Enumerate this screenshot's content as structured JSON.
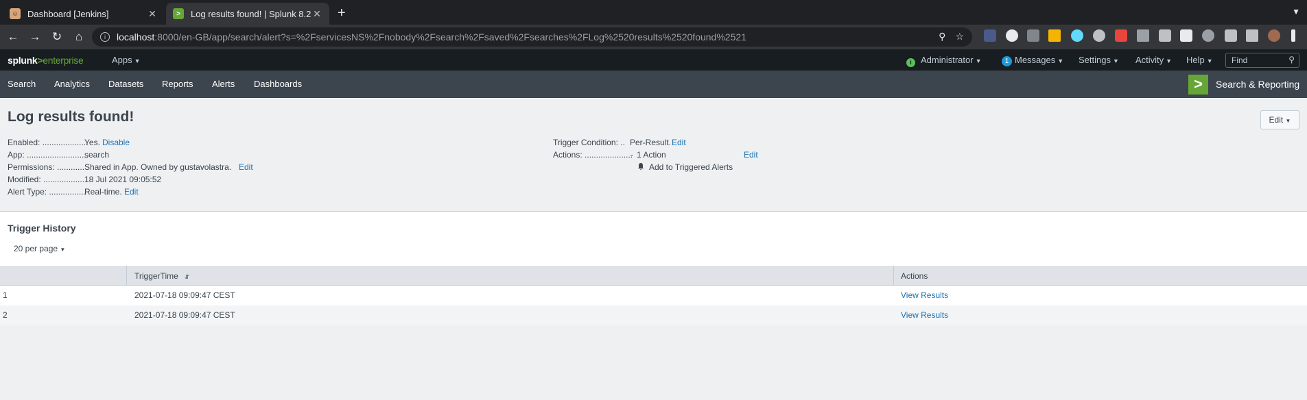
{
  "browser": {
    "tabs": [
      {
        "title": "Dashboard [Jenkins]",
        "active": false
      },
      {
        "title": "Log results found! | Splunk 8.2",
        "active": true
      }
    ],
    "url_host": "localhost",
    "url_rest": ":8000/en-GB/app/search/alert?s=%2FservicesNS%2Fnobody%2Fsearch%2Fsaved%2Fsearches%2FLog%2520results%2520found%2521"
  },
  "splunk_header": {
    "logo_main": "splunk",
    "logo_gt": ">",
    "logo_sub": "enterprise",
    "apps_label": "Apps",
    "user_label": "Administrator",
    "messages_count": "1",
    "messages_label": "Messages",
    "settings_label": "Settings",
    "activity_label": "Activity",
    "help_label": "Help",
    "find_placeholder": "Find"
  },
  "app_nav": {
    "items": [
      "Search",
      "Analytics",
      "Datasets",
      "Reports",
      "Alerts",
      "Dashboards"
    ],
    "app_title": "Search & Reporting"
  },
  "alert": {
    "title": "Log results found!",
    "edit_button": "Edit",
    "enabled_label": "Enabled: ....................",
    "enabled_value": "Yes.",
    "enabled_action": "Disable",
    "app_label": "App: ...........................",
    "app_value": "search",
    "permissions_label": "Permissions: ............",
    "permissions_value": "Shared in App. Owned by gustavolastra.",
    "permissions_action": "Edit",
    "modified_label": "Modified: ..................",
    "modified_value": "18 Jul 2021 09:05:52",
    "alert_type_label": "Alert Type: ................",
    "alert_type_value": "Real-time.",
    "alert_type_action": "Edit",
    "trigger_condition_label": "Trigger Condition: ..",
    "trigger_condition_value": "Per-Result.",
    "trigger_condition_action": "Edit",
    "actions_label": "Actions: .....................",
    "actions_value": "1 Action",
    "actions_edit": "Edit",
    "action_item": "Add to Triggered Alerts"
  },
  "trigger_history": {
    "title": "Trigger History",
    "per_page": "20 per page",
    "columns": [
      "",
      "TriggerTime",
      "Actions"
    ],
    "rows": [
      {
        "index": "1",
        "time": "2021-07-18 09:09:47 CEST",
        "action": "View Results"
      },
      {
        "index": "2",
        "time": "2021-07-18 09:09:47 CEST",
        "action": "View Results"
      }
    ]
  }
}
